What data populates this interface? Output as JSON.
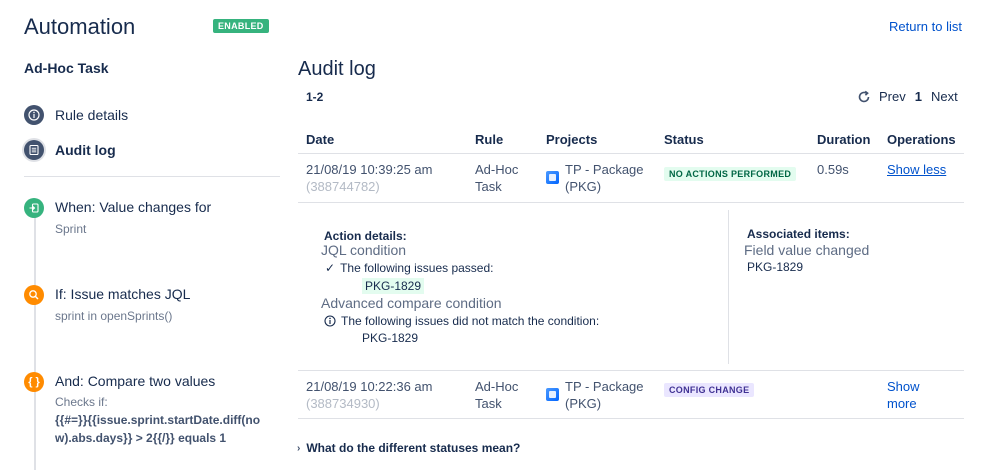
{
  "header": {
    "title": "Automation",
    "enabled_badge": "ENABLED",
    "return_link": "Return to list"
  },
  "sidebar": {
    "rule_name": "Ad-Hoc Task",
    "nav": [
      {
        "label": "Rule details",
        "icon": "info-icon"
      },
      {
        "label": "Audit log",
        "icon": "list-icon",
        "selected": true
      }
    ],
    "steps": [
      {
        "title": "When: Value changes for",
        "sub": "Sprint",
        "icon": "trigger-icon",
        "color": "#36b37e"
      },
      {
        "title": "If: Issue matches JQL",
        "sub": "sprint in openSprints()",
        "icon": "search-icon",
        "color": "#ff8b00"
      },
      {
        "title": "And: Compare two values",
        "sub": "Checks if:",
        "code": "{{#=}}{{issue.sprint.startDate.diff(now).abs.days}} > 2{{/}} equals 1",
        "icon": "braces-icon",
        "icon_text": "{ }",
        "color": "#ff8b00"
      }
    ]
  },
  "main": {
    "heading": "Audit log",
    "range": "1-2",
    "pager": {
      "prev": "Prev",
      "page": "1",
      "next": "Next"
    },
    "columns": [
      "Date",
      "Rule",
      "Projects",
      "Status",
      "Duration",
      "Operations"
    ],
    "rows": [
      {
        "date": "21/08/19 10:39:25 am",
        "id": "(388744782)",
        "rule": "Ad-Hoc Task",
        "project_line1": "TP - Package",
        "project_line2": "(PKG)",
        "status": "NO ACTIONS PERFORMED",
        "duration": "0.59s",
        "operation": "Show less"
      },
      {
        "date": "21/08/19 10:22:36 am",
        "id": "(388734930)",
        "rule": "Ad-Hoc Task",
        "project_line1": "TP - Package",
        "project_line2": "(PKG)",
        "status": "CONFIG CHANGE",
        "duration": "",
        "operation": "Show more"
      }
    ],
    "details": {
      "action_title": "Action details:",
      "jql_title": "JQL condition",
      "jql_passed": "The following issues passed:",
      "jql_issue": "PKG-1829",
      "compare_title": "Advanced compare condition",
      "compare_failed": "The following issues did not match the condition:",
      "compare_issue": "PKG-1829",
      "assoc_title": "Associated items:",
      "assoc_sub": "Field value changed",
      "assoc_issue": "PKG-1829"
    },
    "statuses_link": "What do the different statuses mean?"
  },
  "colors": {
    "accent": "#0052cc",
    "enabled": "#36b37e",
    "nav_icon": "#42526e",
    "step_green": "#36b37e",
    "step_orange": "#ff8b00"
  }
}
